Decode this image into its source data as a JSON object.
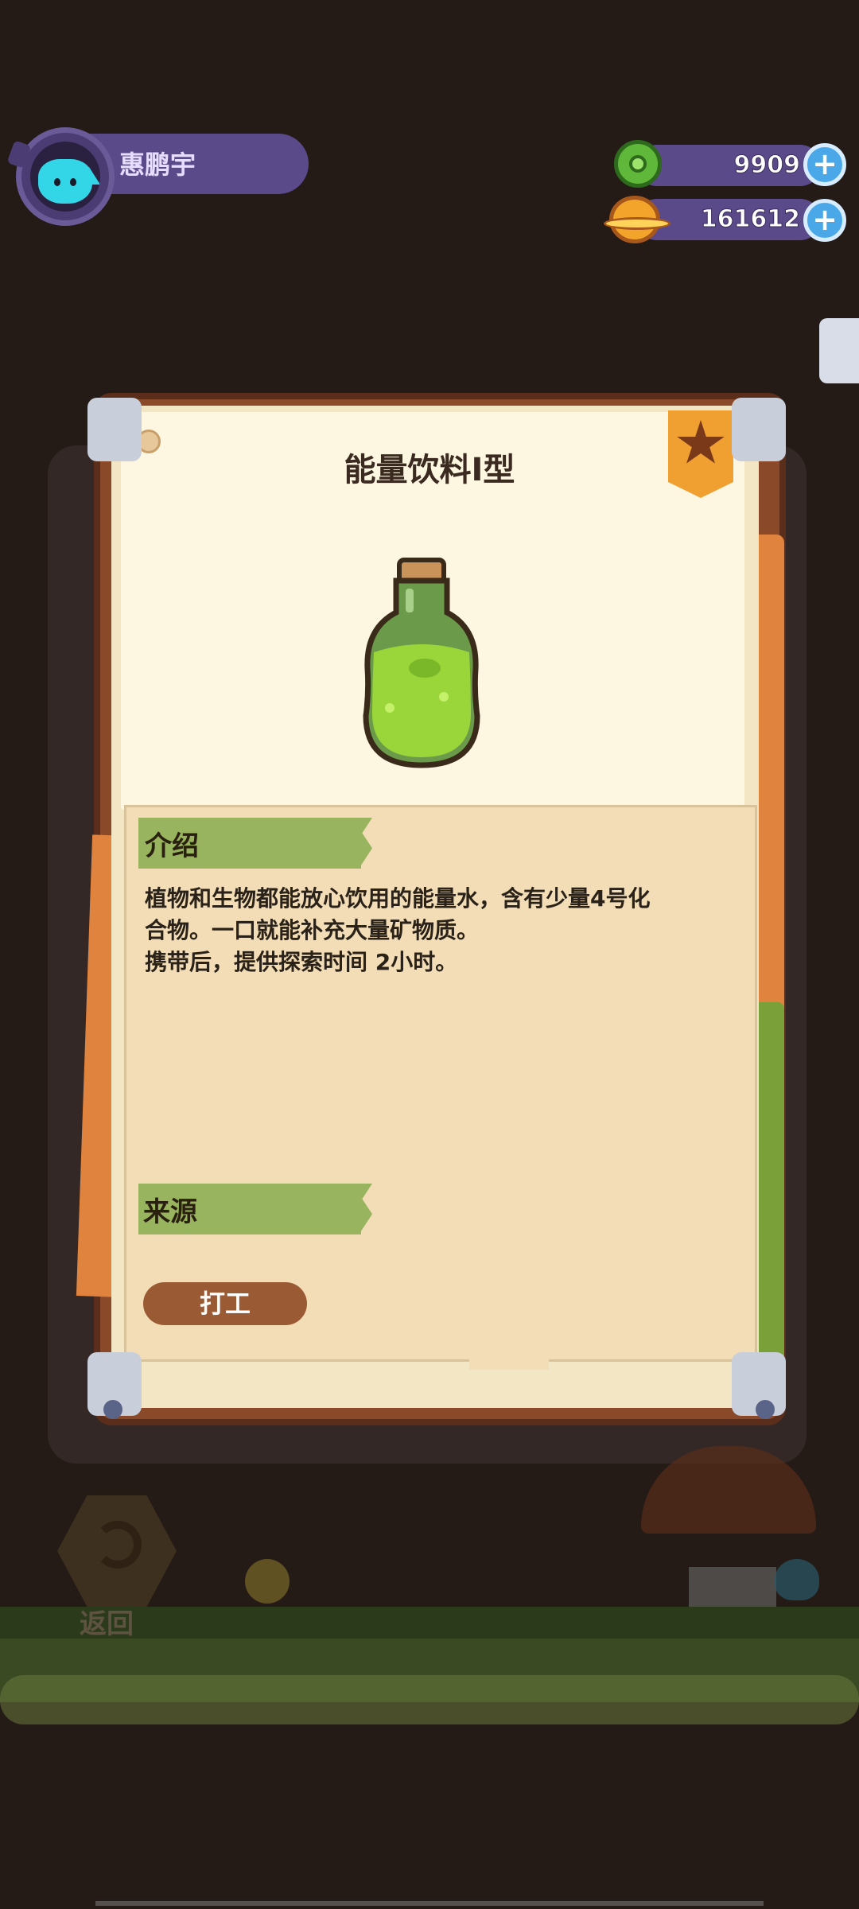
{
  "player": {
    "name": "惠鹏宇"
  },
  "currencies": [
    {
      "icon": "green-gem-coin-icon",
      "value": "9909"
    },
    {
      "icon": "orange-planet-coin-icon",
      "value": "161612"
    }
  ],
  "item": {
    "title": "能量饮料I型",
    "icon": "green-potion-bottle-icon",
    "intro_heading": "介绍",
    "description_lines": [
      "植物和生物都能放心饮用的能量水，含有少量4号化",
      "合物。一口就能补充大量矿物质。",
      "携带后，提供探索时间 2小时。"
    ],
    "source_heading": "来源",
    "source_button": "打工"
  },
  "nav": {
    "back_label": "返回"
  },
  "colors": {
    "background": "#241a16",
    "panel_purple": "#5a4a8a",
    "banner_green": "#99b45e",
    "button_brown": "#9a5a34",
    "plus_blue": "#4aa8e8"
  }
}
